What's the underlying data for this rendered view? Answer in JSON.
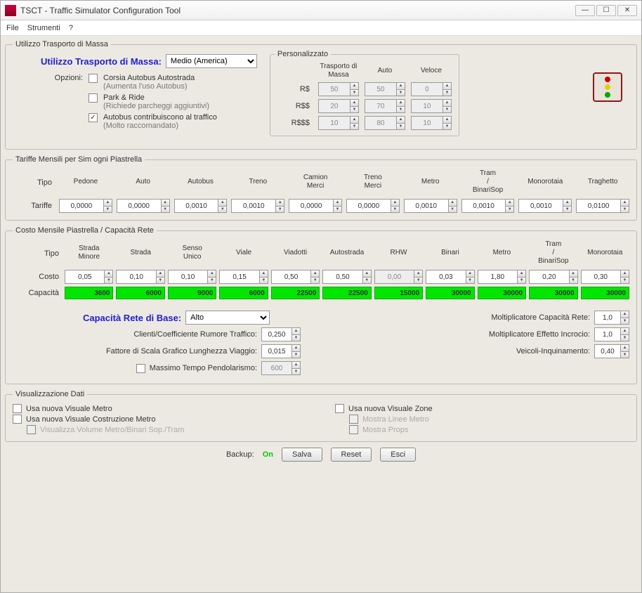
{
  "window": {
    "title": "TSCT - Traffic Simulator Configuration Tool"
  },
  "menu": {
    "file": "File",
    "tools": "Strumenti",
    "help": "?"
  },
  "section1": {
    "legend": "Utilizzo Trasporto di Massa",
    "title": "Utilizzo Trasporto di Massa:",
    "combo": "Medio (America)",
    "opzioni": "Opzioni:",
    "opt1": "Corsia Autobus Autostrada",
    "opt1_hint": "(Aumenta l'uso Autobus)",
    "opt2": "Park & Ride",
    "opt2_hint": "(Richiede parcheggi aggiuntivi)",
    "opt3": "Autobus contribuiscono al traffico",
    "opt3_hint": "(Molto raccomandato)",
    "personal": "Personalizzato",
    "ph1": "Trasporto di Massa",
    "ph2": "Auto",
    "ph3": "Veloce",
    "pr1": "R$",
    "pr2": "R$$",
    "pr3": "R$$$",
    "v": [
      [
        "50",
        "50",
        "0"
      ],
      [
        "20",
        "70",
        "10"
      ],
      [
        "10",
        "80",
        "10"
      ]
    ]
  },
  "tariffe": {
    "legend": "Tariffe Mensili per Sim ogni Piastrella",
    "tipo": "Tipo",
    "rowlabel": "Tariffe",
    "headers": [
      "Pedone",
      "Auto",
      "Autobus",
      "Treno",
      "Camion Merci",
      "Treno Merci",
      "Metro",
      "Tram / BinariSop",
      "Monorotaia",
      "Traghetto"
    ],
    "values": [
      "0,0000",
      "0,0000",
      "0,0010",
      "0,0010",
      "0,0000",
      "0,0000",
      "0,0010",
      "0,0010",
      "0,0010",
      "0,0100"
    ]
  },
  "costo": {
    "legend": "Costo Mensile Piastrella / Capacità Rete",
    "tipo": "Tipo",
    "rowcosto": "Costo",
    "rowcap": "Capacità",
    "headers": [
      "Strada Minore",
      "Strada",
      "Senso Unico",
      "Viale",
      "Viadotti",
      "Autostrada",
      "RHW",
      "Binari",
      "Metro",
      "Tram / BinariSop",
      "Monorotaia"
    ],
    "cost": [
      "0,05",
      "0,10",
      "0,10",
      "0,15",
      "0,50",
      "0,50",
      "0,00",
      "0,03",
      "1,80",
      "0,20",
      "0,30"
    ],
    "cap": [
      "3600",
      "6000",
      "9000",
      "6000",
      "22500",
      "22500",
      "15000",
      "30000",
      "30000",
      "30000",
      "30000"
    ],
    "base_label": "Capacità Rete di Base:",
    "base_combo": "Alto",
    "p1": "Clienti/Coefficiente Rumore Traffico:",
    "p1v": "0,250",
    "p2": "Fattore di Scala Grafico Lunghezza Viaggio:",
    "p2v": "0,015",
    "p3": "Massimo Tempo Pendolarismo:",
    "p3v": "600",
    "r1": "Moltiplicatore Capacità Rete:",
    "r1v": "1,0",
    "r2": "Moltiplicatore Effetto Incrocio:",
    "r2v": "1,0",
    "r3": "Veicoli-Inquinamento:",
    "r3v": "0,40"
  },
  "viz": {
    "legend": "Visualizzazione Dati",
    "a": "Usa nuova Visuale Metro",
    "b": "Usa nuova Visuale Costruzione Metro",
    "c": "Visualizza Volume Metro/Binari Sop./Tram",
    "d": "Usa nuova Visuale Zone",
    "e": "Mostra Linee Metro",
    "f": "Mostra Props"
  },
  "footer": {
    "backup": "Backup:",
    "on": "On",
    "salva": "Salva",
    "reset": "Reset",
    "esci": "Esci"
  }
}
